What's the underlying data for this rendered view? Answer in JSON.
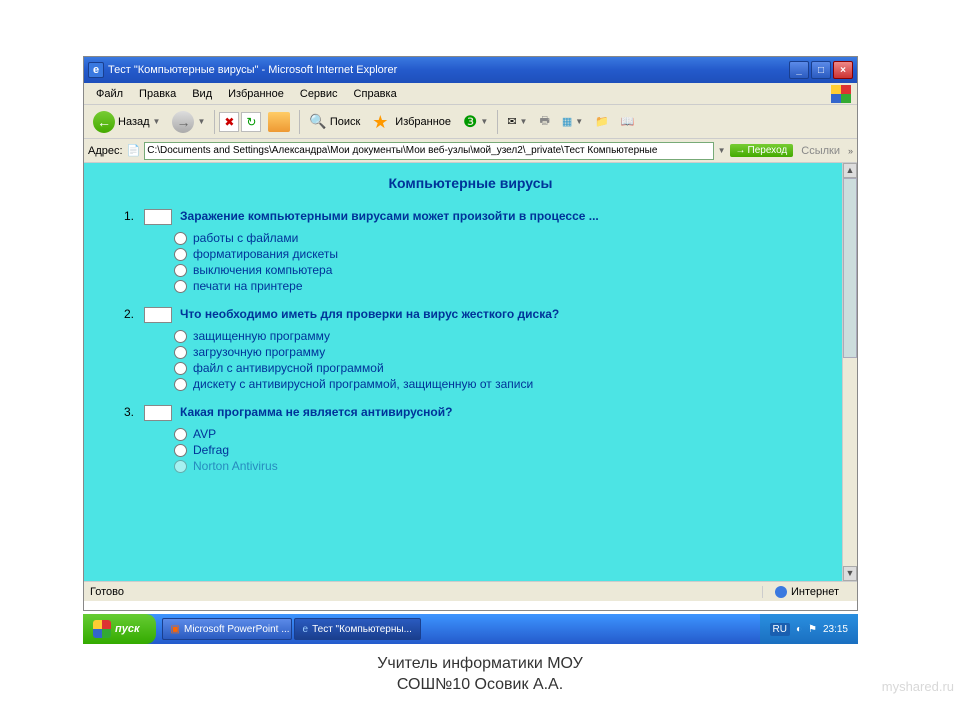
{
  "window": {
    "title": "Тест \"Компьютерные вирусы\" - Microsoft Internet Explorer"
  },
  "menu": {
    "file": "Файл",
    "edit": "Правка",
    "view": "Вид",
    "favorites": "Избранное",
    "tools": "Сервис",
    "help": "Справка"
  },
  "toolbar": {
    "back": "Назад",
    "search": "Поиск",
    "favs": "Избранное"
  },
  "address": {
    "label": "Адрес:",
    "value": "C:\\Documents and Settings\\Александра\\Мои документы\\Мои веб-узлы\\мой_узел2\\_private\\Тест Компьютерные",
    "go": "Переход",
    "links": "Ссылки"
  },
  "page": {
    "title": "Компьютерные вирусы",
    "questions": [
      {
        "num": "1.",
        "text": "Заражение компьютерными вирусами может произойти в процессе ...",
        "options": [
          "работы с файлами",
          "форматирования дискеты",
          "выключения компьютера",
          "печати на принтере"
        ]
      },
      {
        "num": "2.",
        "text": "Что необходимо иметь для проверки на вирус жесткого диска?",
        "options": [
          "защищенную программу",
          "загрузочную программу",
          "файл с антивирусной программой",
          "дискету с антивирусной программой, защищенную от записи"
        ]
      },
      {
        "num": "3.",
        "text": "Какая программа не является антивирусной?",
        "options": [
          "AVP",
          "Defrag",
          "Norton Antivirus"
        ]
      }
    ]
  },
  "status": {
    "ready": "Готово",
    "zone": "Интернет"
  },
  "taskbar": {
    "start": "пуск",
    "task1": "Microsoft PowerPoint ...",
    "task2": "Тест \"Компьютерны...",
    "lang": "RU",
    "time": "23:15"
  },
  "footer": {
    "line1": "Учитель информатики МОУ",
    "line2": "СОШ№10 Осовик А.А."
  },
  "watermark": "myshared.ru"
}
